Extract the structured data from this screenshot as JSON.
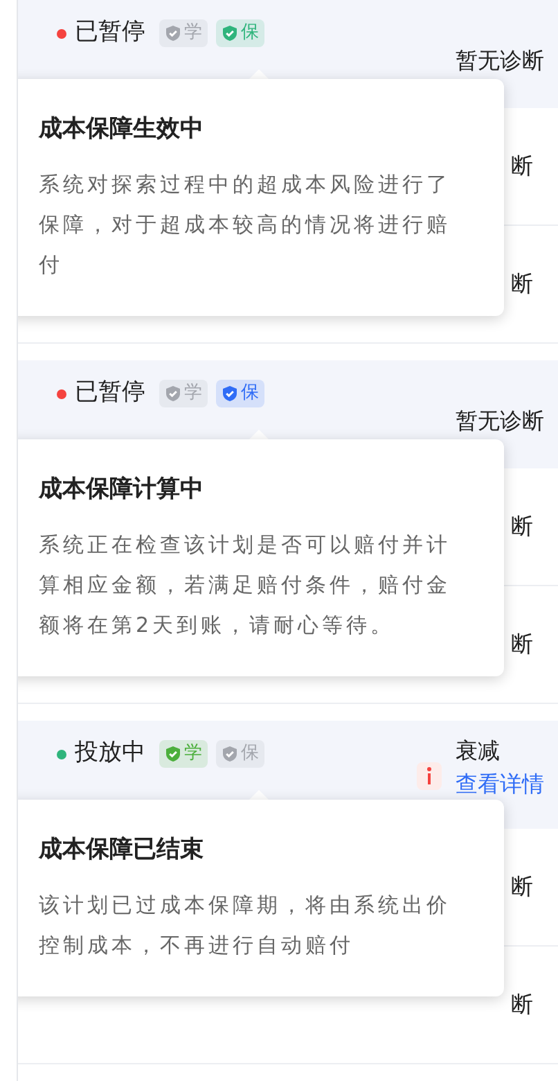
{
  "panels": [
    {
      "status": {
        "text": "已暂停",
        "color": "#f5433f"
      },
      "badges": [
        {
          "text": "学",
          "color": "#a3a6ad"
        },
        {
          "text": "保",
          "color": "#2fb47c"
        }
      ],
      "diagnosis": {
        "kind": "text",
        "text": "暂无诊断"
      },
      "tooltip": {
        "title": "成本保障生效中",
        "body": "系统对探索过程中的超成本风险进行了保障，对于超成本较高的情况将进行赔付"
      },
      "fragments": [
        "断",
        "断"
      ]
    },
    {
      "status": {
        "text": "已暂停",
        "color": "#f5433f"
      },
      "badges": [
        {
          "text": "学",
          "color": "#a3a6ad"
        },
        {
          "text": "保",
          "color": "#2f6cf6"
        }
      ],
      "diagnosis": {
        "kind": "text",
        "text": "暂无诊断"
      },
      "tooltip": {
        "title": "成本保障计算中",
        "body": "系统正在检查该计划是否可以赔付并计算相应金额，若满足赔付条件，赔付金额将在第2天到账，请耐心等待。"
      },
      "fragments": [
        "断",
        "断"
      ]
    },
    {
      "status": {
        "text": "投放中",
        "color": "#2fb47c"
      },
      "badges": [
        {
          "text": "学",
          "color": "#4caf3c"
        },
        {
          "text": "保",
          "color": "#a3a6ad"
        }
      ],
      "diagnosis": {
        "kind": "warning",
        "text": "衰减",
        "link": "查看详情"
      },
      "tooltip": {
        "title": "成本保障已结束",
        "body": "该计划已过成本保障期，将由系统出价控制成本，不再进行自动赔付"
      },
      "fragments": [
        "断",
        "断"
      ]
    }
  ]
}
